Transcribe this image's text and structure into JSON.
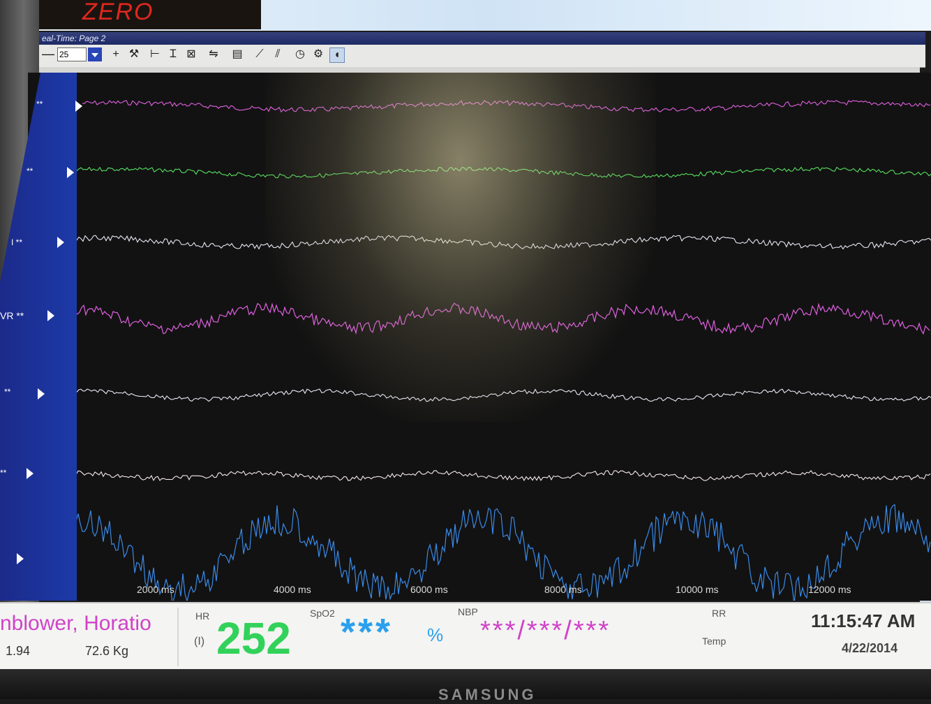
{
  "app": {
    "brand": "ZERO",
    "window_title": "eal-Time: Page 2"
  },
  "colors": {
    "magenta": "#e060e0",
    "green": "#58e060",
    "white": "#e8e8f4",
    "blue": "#3a8ae8",
    "hr": "#32d25a",
    "spo2": "#2aa0ee",
    "nbp": "#d042c8"
  },
  "toolbar": {
    "value": "25",
    "icons": [
      "minus-icon",
      "plus-icon",
      "tools-icon",
      "h-measure-icon",
      "i-beam-icon",
      "clear-icon",
      "auto-scale-icon",
      "print-icon",
      "ruler-icon",
      "ruler-alt-icon",
      "clock-icon",
      "settings-icon",
      "sound-icon"
    ],
    "glyphs": [
      "—",
      "+",
      "⚒",
      "⊢",
      "Ɪ",
      "⊠",
      "⇋",
      "▤",
      "⟋",
      "⫽",
      "◷",
      "⚙",
      "🔊"
    ]
  },
  "channels": [
    {
      "label": "**",
      "color": "#e060e0"
    },
    {
      "label": "**",
      "color": "#58e060"
    },
    {
      "label": "I **",
      "color": "#e8e8f4"
    },
    {
      "label": "VR **",
      "color": "#e060e0"
    },
    {
      "label": "**",
      "color": "#e8e8f4"
    },
    {
      "label": "**",
      "color": "#f4e8f0"
    },
    {
      "label": "",
      "color": "#3a8ae8"
    }
  ],
  "time_axis": {
    "ticks": [
      "2000 ms",
      "4000 ms",
      "6000 ms",
      "8000 ms",
      "10000 ms",
      "12000 ms"
    ]
  },
  "patient": {
    "name": "nblower, Horatio",
    "height": "1.94",
    "weight": "72.6 Kg"
  },
  "vitals": {
    "hr_label": "HR",
    "hr_lead": "(I)",
    "hr_value": "252",
    "spo2_label": "SpO2",
    "spo2_value": "***",
    "spo2_unit": "%",
    "nbp_label": "NBP",
    "nbp_value": "***/***/***",
    "rr_label": "RR",
    "temp_label": "Temp"
  },
  "clock": {
    "time": "11:15:47 AM",
    "date": "4/22/2014"
  },
  "monitor": {
    "maker": "SAMSUNG"
  }
}
